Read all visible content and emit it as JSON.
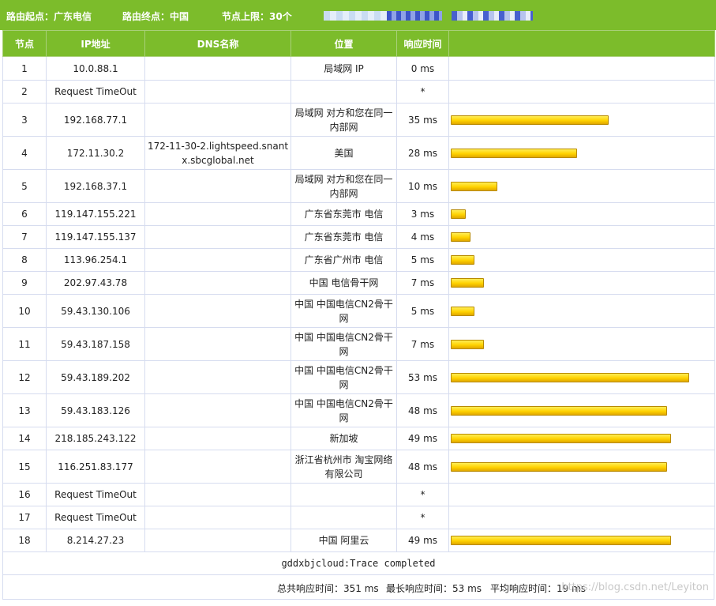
{
  "header": {
    "start_label": "路由起点：广东电信",
    "end_label": "路由终点：中国",
    "hop_limit_label": "节点上限：30个"
  },
  "columns": [
    "节点",
    "IP地址",
    "DNS名称",
    "位置",
    "响应时间",
    ""
  ],
  "rows": [
    {
      "hop": "1",
      "ip": "10.0.88.1",
      "dns": "",
      "loc": "局域网 IP",
      "time": "0 ms",
      "ms": 0
    },
    {
      "hop": "2",
      "ip": "Request TimeOut",
      "dns": "",
      "loc": "",
      "time": "*",
      "ms": 0
    },
    {
      "hop": "3",
      "ip": "192.168.77.1",
      "dns": "",
      "loc": "局域网 对方和您在同一内部网",
      "time": "35 ms",
      "ms": 35
    },
    {
      "hop": "4",
      "ip": "172.11.30.2",
      "dns": "172-11-30-2.lightspeed.snantx.sbcglobal.net",
      "loc": "美国",
      "time": "28 ms",
      "ms": 28
    },
    {
      "hop": "5",
      "ip": "192.168.37.1",
      "dns": "",
      "loc": "局域网 对方和您在同一内部网",
      "time": "10 ms",
      "ms": 10
    },
    {
      "hop": "6",
      "ip": "119.147.155.221",
      "dns": "",
      "loc": "广东省东莞市 电信",
      "time": "3 ms",
      "ms": 3
    },
    {
      "hop": "7",
      "ip": "119.147.155.137",
      "dns": "",
      "loc": "广东省东莞市 电信",
      "time": "4 ms",
      "ms": 4
    },
    {
      "hop": "8",
      "ip": "113.96.254.1",
      "dns": "",
      "loc": "广东省广州市 电信",
      "time": "5 ms",
      "ms": 5
    },
    {
      "hop": "9",
      "ip": "202.97.43.78",
      "dns": "",
      "loc": "中国 电信骨干网",
      "time": "7 ms",
      "ms": 7
    },
    {
      "hop": "10",
      "ip": "59.43.130.106",
      "dns": "",
      "loc": "中国 中国电信CN2骨干网",
      "time": "5 ms",
      "ms": 5
    },
    {
      "hop": "11",
      "ip": "59.43.187.158",
      "dns": "",
      "loc": "中国 中国电信CN2骨干网",
      "time": "7 ms",
      "ms": 7
    },
    {
      "hop": "12",
      "ip": "59.43.189.202",
      "dns": "",
      "loc": "中国 中国电信CN2骨干网",
      "time": "53 ms",
      "ms": 53
    },
    {
      "hop": "13",
      "ip": "59.43.183.126",
      "dns": "",
      "loc": "中国 中国电信CN2骨干网",
      "time": "48 ms",
      "ms": 48
    },
    {
      "hop": "14",
      "ip": "218.185.243.122",
      "dns": "",
      "loc": "新加坡",
      "time": "49 ms",
      "ms": 49
    },
    {
      "hop": "15",
      "ip": "116.251.83.177",
      "dns": "",
      "loc": "浙江省杭州市 淘宝网络有限公司",
      "time": "48 ms",
      "ms": 48
    },
    {
      "hop": "16",
      "ip": "Request TimeOut",
      "dns": "",
      "loc": "",
      "time": "*",
      "ms": 0
    },
    {
      "hop": "17",
      "ip": "Request TimeOut",
      "dns": "",
      "loc": "",
      "time": "*",
      "ms": 0
    },
    {
      "hop": "18",
      "ip": "8.214.27.23",
      "dns": "",
      "loc": "中国 阿里云",
      "time": "49 ms",
      "ms": 49
    }
  ],
  "footer": {
    "status": "gddxbjcloud:Trace completed",
    "total": "总共响应时间：351 ms",
    "max": "最长响应时间：53 ms",
    "avg": "平均响应时间：19 ms",
    "watermark": "https://blog.csdn.net/Leyiton"
  },
  "colors": {
    "accent": "#7cbc2b",
    "bar": "#ffd200"
  }
}
